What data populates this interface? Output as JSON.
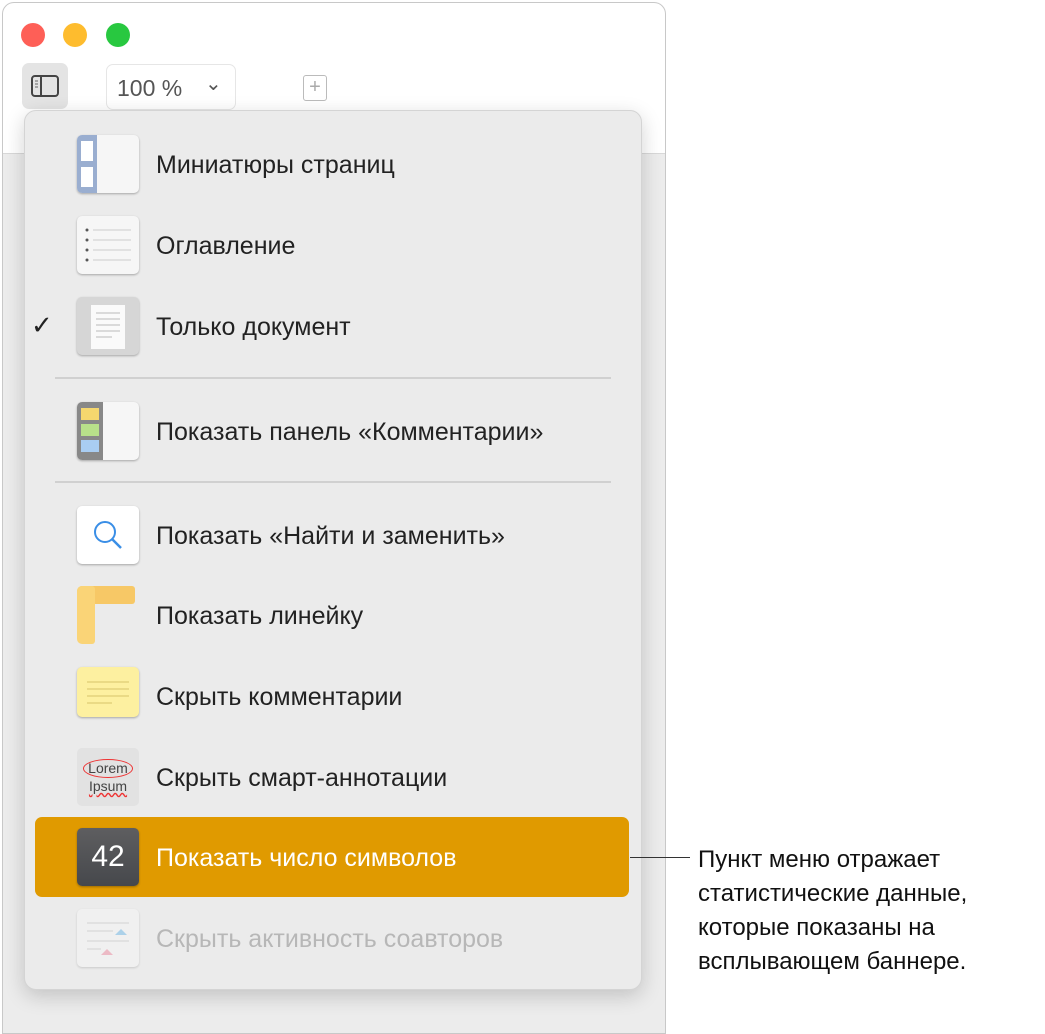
{
  "toolbar": {
    "zoom": "100 %"
  },
  "menu": {
    "items": [
      {
        "label": "Миниатюры страниц",
        "icon": "page-thumbnails-icon"
      },
      {
        "label": "Оглавление",
        "icon": "table-of-contents-icon"
      },
      {
        "label": "Только документ",
        "icon": "document-only-icon",
        "checked": true
      },
      {
        "label": "Показать панель «Комментарии»",
        "icon": "comments-pane-icon"
      },
      {
        "label": "Показать «Найти и заменить»",
        "icon": "find-replace-icon"
      },
      {
        "label": "Показать линейку",
        "icon": "ruler-icon"
      },
      {
        "label": "Скрыть комментарии",
        "icon": "comment-note-icon"
      },
      {
        "label": "Скрыть смарт-аннотации",
        "icon": "smart-annotation-icon",
        "icon_text1": "Lorem",
        "icon_text2": "Ipsum"
      },
      {
        "label": "Показать число символов",
        "icon": "word-count-icon",
        "icon_text": "42",
        "highlighted": true
      },
      {
        "label": "Скрыть активность соавторов",
        "icon": "collaboration-activity-icon",
        "disabled": true
      }
    ]
  },
  "callout": {
    "lines": [
      "Пункт меню отражает",
      "статистические данные,",
      "которые показаны на",
      "всплывающем баннере."
    ]
  },
  "colors": {
    "highlight": "#e09a00"
  }
}
